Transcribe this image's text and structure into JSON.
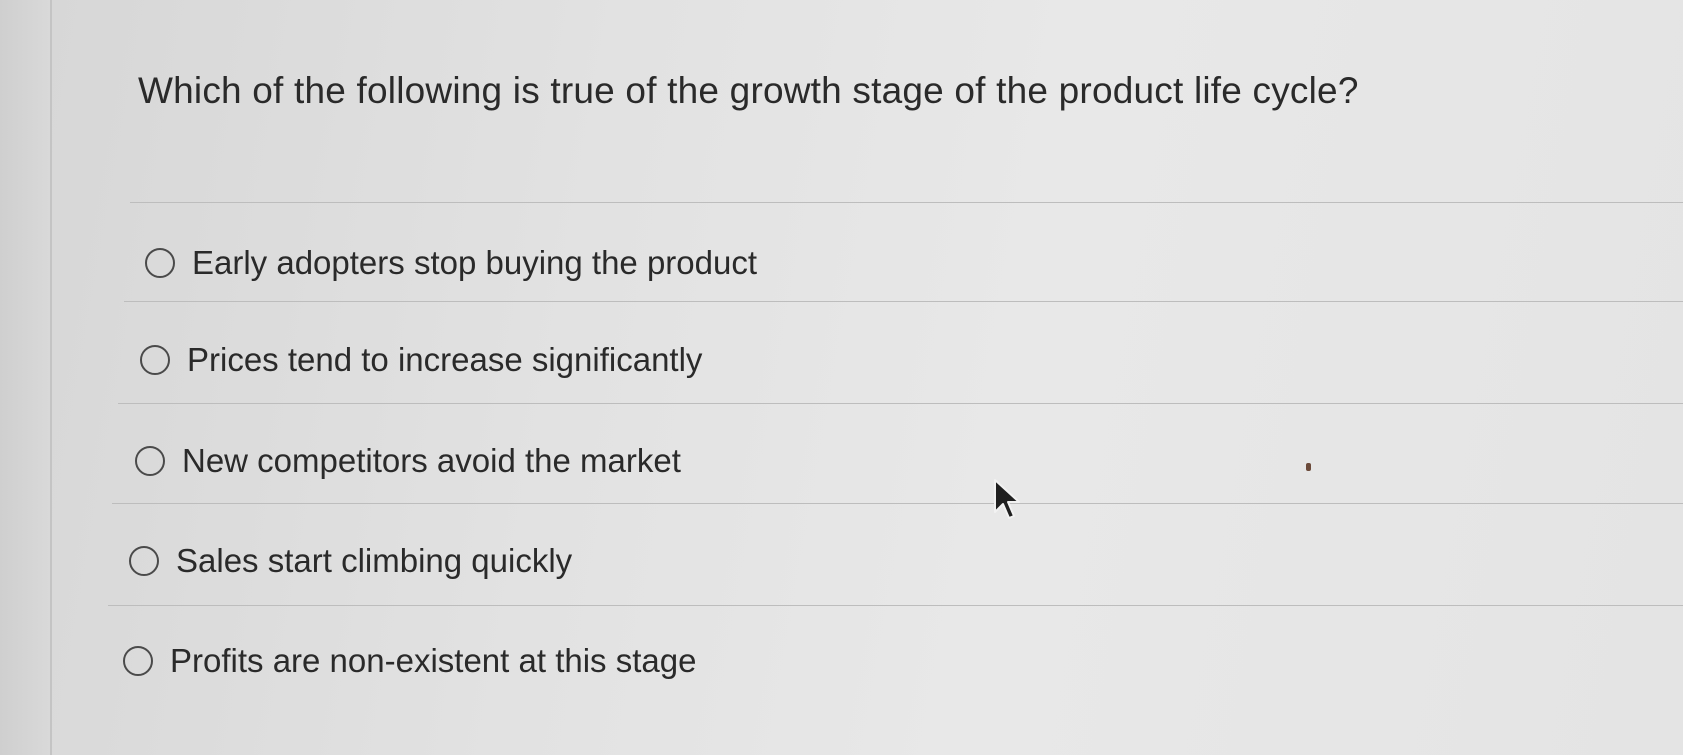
{
  "question": {
    "text": "Which of the following is true of the growth stage of the product life cycle?"
  },
  "options": [
    {
      "label": "Early adopters stop buying the product",
      "selected": false
    },
    {
      "label": "Prices tend to increase significantly",
      "selected": false
    },
    {
      "label": "New competitors avoid the market",
      "selected": false
    },
    {
      "label": "Sales start climbing quickly",
      "selected": false
    },
    {
      "label": "Profits are non-existent at this stage",
      "selected": false
    }
  ],
  "icons": {
    "option_radio": "radio-button-empty-icon",
    "cursor": "mouse-pointer-icon"
  },
  "colors": {
    "background": "#e4e4e4",
    "text": "#2a2a2a",
    "divider": "#bdbdbd"
  }
}
